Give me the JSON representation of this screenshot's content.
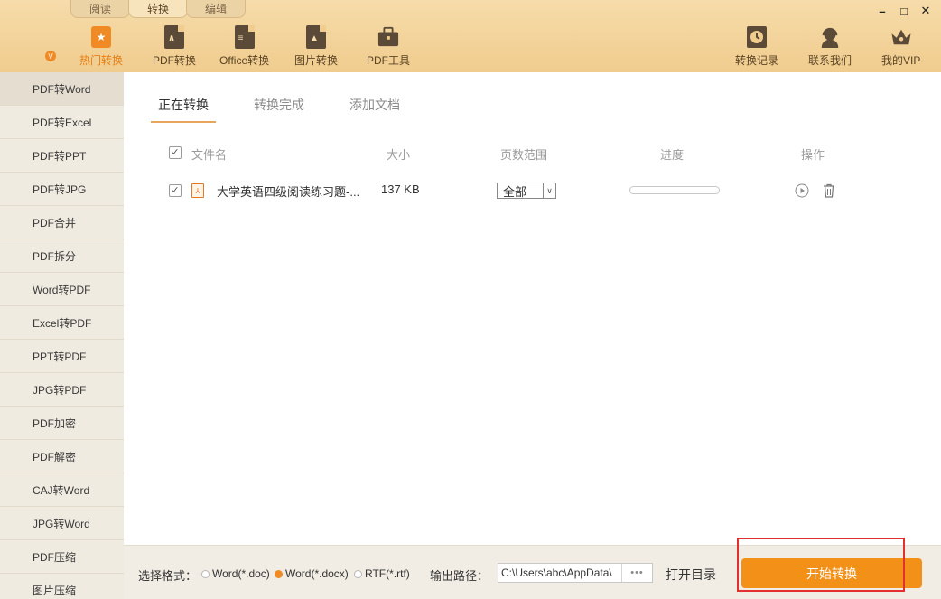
{
  "mode_tabs": [
    "阅读",
    "转换",
    "编辑"
  ],
  "toolbar": {
    "left": [
      {
        "label": "热门转换",
        "icon": "star-icon"
      },
      {
        "label": "PDF转换",
        "icon": "pdf-icon"
      },
      {
        "label": "Office转换",
        "icon": "office-icon"
      },
      {
        "label": "图片转换",
        "icon": "image-icon"
      },
      {
        "label": "PDF工具",
        "icon": "toolbox-icon"
      }
    ],
    "right": [
      {
        "label": "转换记录",
        "icon": "history-icon"
      },
      {
        "label": "联系我们",
        "icon": "headset-icon"
      },
      {
        "label": "我的VIP",
        "icon": "crown-icon"
      }
    ]
  },
  "window_controls": {
    "minimize": "–",
    "maximize": "□",
    "close": "✕"
  },
  "sidebar": [
    "PDF转Word",
    "PDF转Excel",
    "PDF转PPT",
    "PDF转JPG",
    "PDF合并",
    "PDF拆分",
    "Word转PDF",
    "Excel转PDF",
    "PPT转PDF",
    "JPG转PDF",
    "PDF加密",
    "PDF解密",
    "CAJ转Word",
    "JPG转Word",
    "PDF压缩",
    "图片压缩"
  ],
  "tabs": [
    "正在转换",
    "转换完成",
    "添加文档"
  ],
  "table": {
    "headers": {
      "name": "文件名",
      "size": "大小",
      "pages": "页数范围",
      "progress": "进度",
      "ops": "操作"
    },
    "rows": [
      {
        "name": "大学英语四级阅读练习题-...",
        "size": "137 KB",
        "pages": "全部",
        "progress": 0
      }
    ]
  },
  "footer": {
    "format_label": "选择格式：",
    "formats": [
      {
        "label": "Word(*.doc)",
        "selected": false
      },
      {
        "label": "Word(*.docx)",
        "selected": true
      },
      {
        "label": "RTF(*.rtf)",
        "selected": false
      }
    ],
    "path_label": "输出路径：",
    "path_value": "C:\\Users\\abc\\AppData\\",
    "more": "•••",
    "open_dir": "打开目录",
    "start": "开始转换"
  },
  "colors": {
    "accent": "#f39018",
    "toolbar": "#f0cc8e",
    "sidebar": "#f0ebe0",
    "highlight": "#e23030"
  }
}
